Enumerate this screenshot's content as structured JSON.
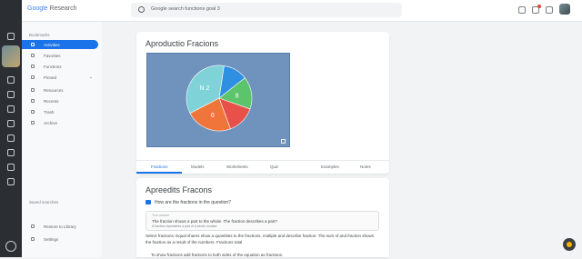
{
  "app": {
    "logo_brand": "Google",
    "logo_text": "Research"
  },
  "search": {
    "placeholder": "Google search functions goal 3"
  },
  "icons": {
    "rail": [
      "grid-icon",
      "inbox-icon",
      "tasks-icon",
      "calendar-icon",
      "chart-icon",
      "folder-icon",
      "bookmark-icon",
      "clock-icon",
      "settings-icon"
    ],
    "topbar": [
      "notes-icon",
      "notifications-icon",
      "apps-icon"
    ]
  },
  "sidebar": {
    "header": "Bookmarks",
    "items": [
      {
        "label": "Activities",
        "active": true
      },
      {
        "label": "Favorites",
        "active": false
      },
      {
        "label": "Functions",
        "active": false
      },
      {
        "label": "Pinned",
        "active": false,
        "expandable": true
      },
      {
        "label": "Resources",
        "active": false
      },
      {
        "label": "Recents",
        "active": false
      },
      {
        "label": "Trash",
        "active": false
      },
      {
        "label": "Archive",
        "active": false
      }
    ],
    "footer_header": "Saved searches",
    "footer_items": [
      {
        "label": "Restore to Library"
      },
      {
        "label": "Settings"
      }
    ]
  },
  "card1": {
    "title": "Aproductio Fracions",
    "tabs": [
      "Fractions",
      "Models",
      "Worksheets",
      "Quiz",
      "Examples",
      "Notes"
    ],
    "active_tab": 0
  },
  "chart_data": {
    "type": "pie",
    "slices": [
      {
        "label": "",
        "value": 12,
        "color": "#2f8fe0"
      },
      {
        "label": "8",
        "value": 16,
        "color": "#5cc46b"
      },
      {
        "label": "",
        "value": 14,
        "color": "#e8504a"
      },
      {
        "label": "6",
        "value": 23,
        "color": "#f0753a"
      },
      {
        "label": "N 2",
        "value": 35,
        "color": "#7fd3d8"
      }
    ],
    "background": "#6f93bd"
  },
  "card2": {
    "title": "Apreedits Fracons",
    "question": "How are the fractions in the question?",
    "answer_placeholder": "Your answer",
    "answer_line1": "The fraction shows a part to the whole. The fraction describes a part?",
    "answer_line2": "A fraction represents a part of a whole number",
    "bullet1": "Select fractions: Equal shares show a quantities to the fractions, multiple and describe fraction. The sum of and fraction shows the fraction as a result of the numbers. Fractions total",
    "bullet2": "To show fractions add fractions to both sides of the equation as fractions."
  }
}
